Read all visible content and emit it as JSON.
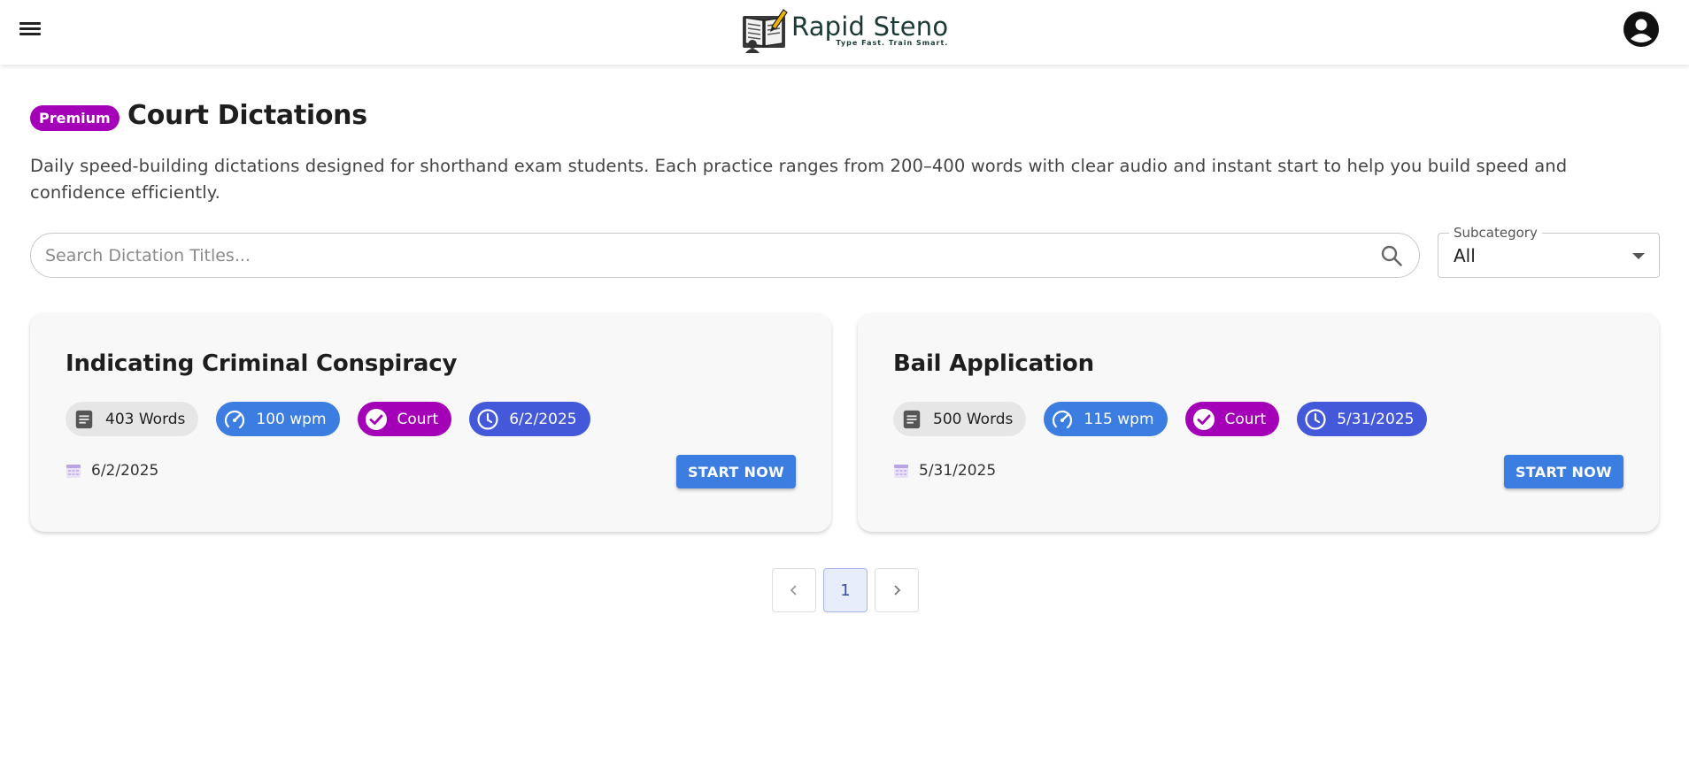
{
  "header": {
    "brand_name": "Rapid Steno",
    "brand_tagline": "Type Fast. Train Smart.",
    "menu_icon": "hamburger-menu-icon",
    "account_icon": "account-circle-icon"
  },
  "page": {
    "badge": "Premium",
    "title": "Court Dictations",
    "description": "Daily speed-building dictations designed for shorthand exam students. Each practice ranges from 200–400 words with clear audio and instant start to help you build speed and confidence efficiently."
  },
  "search": {
    "placeholder": "Search Dictation Titles...",
    "value": ""
  },
  "subcategory": {
    "label": "Subcategory",
    "value": "All"
  },
  "cards": [
    {
      "title": "Indicating Criminal Conspiracy",
      "words": "403 Words",
      "speed": "100 wpm",
      "category": "Court",
      "chip_date": "6/2/2025",
      "date": "6/2/2025",
      "action": "START NOW"
    },
    {
      "title": "Bail Application",
      "words": "500 Words",
      "speed": "115 wpm",
      "category": "Court",
      "chip_date": "5/31/2025",
      "date": "5/31/2025",
      "action": "START NOW"
    }
  ],
  "pagination": {
    "current": "1"
  },
  "colors": {
    "premium": "#a300b8",
    "primary_button": "#3b7de0",
    "date_chip": "#4459d9"
  }
}
